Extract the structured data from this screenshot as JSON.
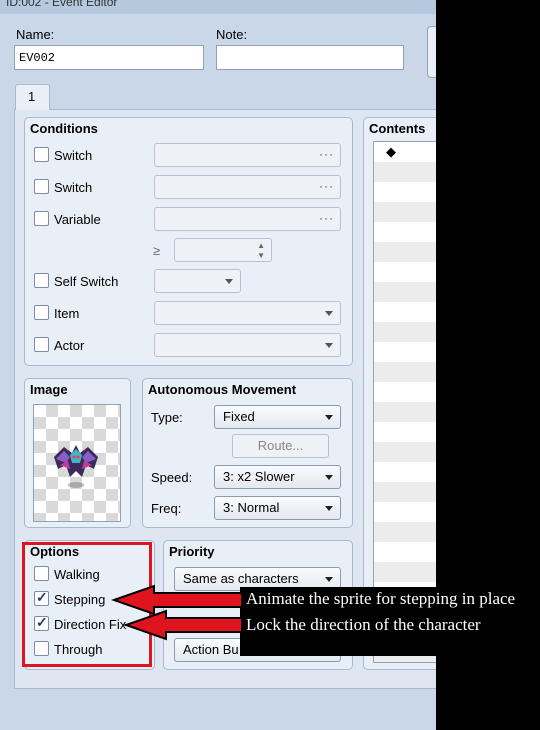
{
  "window": {
    "title": "ID:002 - Event Editor"
  },
  "header": {
    "name_label": "Name:",
    "name_value": "EV002",
    "note_label": "Note:",
    "note_value": ""
  },
  "tabs": [
    {
      "label": "1"
    }
  ],
  "conditions": {
    "title": "Conditions",
    "items": [
      {
        "label": "Switch",
        "checked": false
      },
      {
        "label": "Switch",
        "checked": false
      },
      {
        "label": "Variable",
        "checked": false
      },
      {
        "label": "Self Switch",
        "checked": false
      },
      {
        "label": "Item",
        "checked": false
      },
      {
        "label": "Actor",
        "checked": false
      }
    ],
    "ellipsis": "···",
    "gte_symbol": "≥"
  },
  "image": {
    "title": "Image"
  },
  "movement": {
    "title": "Autonomous Movement",
    "type_label": "Type:",
    "type_value": "Fixed",
    "route_button": "Route...",
    "speed_label": "Speed:",
    "speed_value": "3: x2 Slower",
    "freq_label": "Freq:",
    "freq_value": "3: Normal"
  },
  "options": {
    "title": "Options",
    "items": [
      {
        "label": "Walking",
        "checked": false
      },
      {
        "label": "Stepping",
        "checked": true
      },
      {
        "label": "Direction Fix",
        "checked": true
      },
      {
        "label": "Through",
        "checked": false
      }
    ]
  },
  "priority": {
    "title": "Priority",
    "value": "Same as characters",
    "trigger_partial": "Action Bu"
  },
  "contents": {
    "title": "Contents",
    "first_row_marker": "◆"
  },
  "annotations": {
    "stepping_note": "Animate the sprite for stepping in place",
    "direction_note": "Lock the direction of the character",
    "highlight_color": "#e0141e"
  }
}
